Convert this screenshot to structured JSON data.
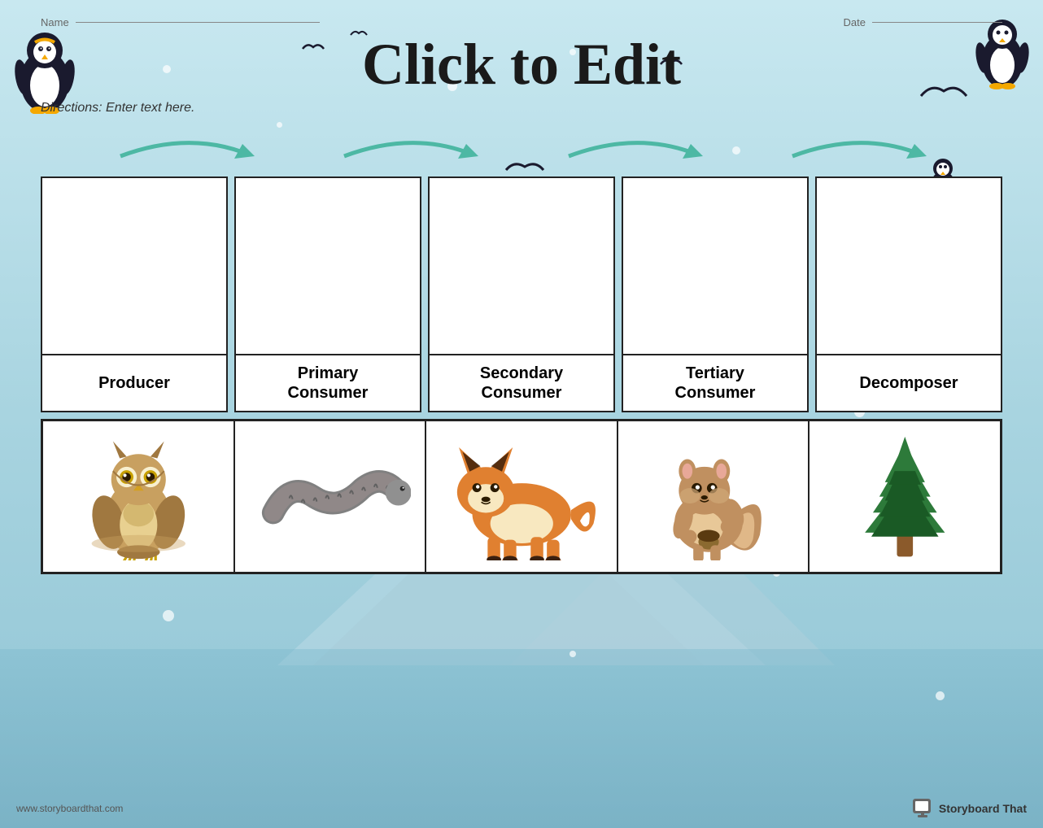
{
  "header": {
    "name_label": "Name",
    "date_label": "Date",
    "title": "Click to Edit",
    "directions": "Directions: Enter text here."
  },
  "labels": [
    {
      "id": "producer",
      "text": "Producer"
    },
    {
      "id": "primary-consumer",
      "text": "Primary\nConsumer"
    },
    {
      "id": "secondary-consumer",
      "text": "Secondary\nConsumer"
    },
    {
      "id": "tertiary-consumer",
      "text": "Tertiary\nConsumer"
    },
    {
      "id": "decomposer",
      "text": "Decomposer"
    }
  ],
  "animals": [
    {
      "id": "owl",
      "name": "Owl"
    },
    {
      "id": "worm",
      "name": "Worm"
    },
    {
      "id": "fox",
      "name": "Fox"
    },
    {
      "id": "squirrel",
      "name": "Squirrel"
    },
    {
      "id": "tree",
      "name": "Pine Tree"
    }
  ],
  "footer": {
    "url": "www.storyboardthat.com",
    "brand": "Storyboard That"
  },
  "colors": {
    "bg": "#b8dce8",
    "mountain": "#a8ccd8",
    "white": "#ffffff",
    "border": "#222222"
  }
}
